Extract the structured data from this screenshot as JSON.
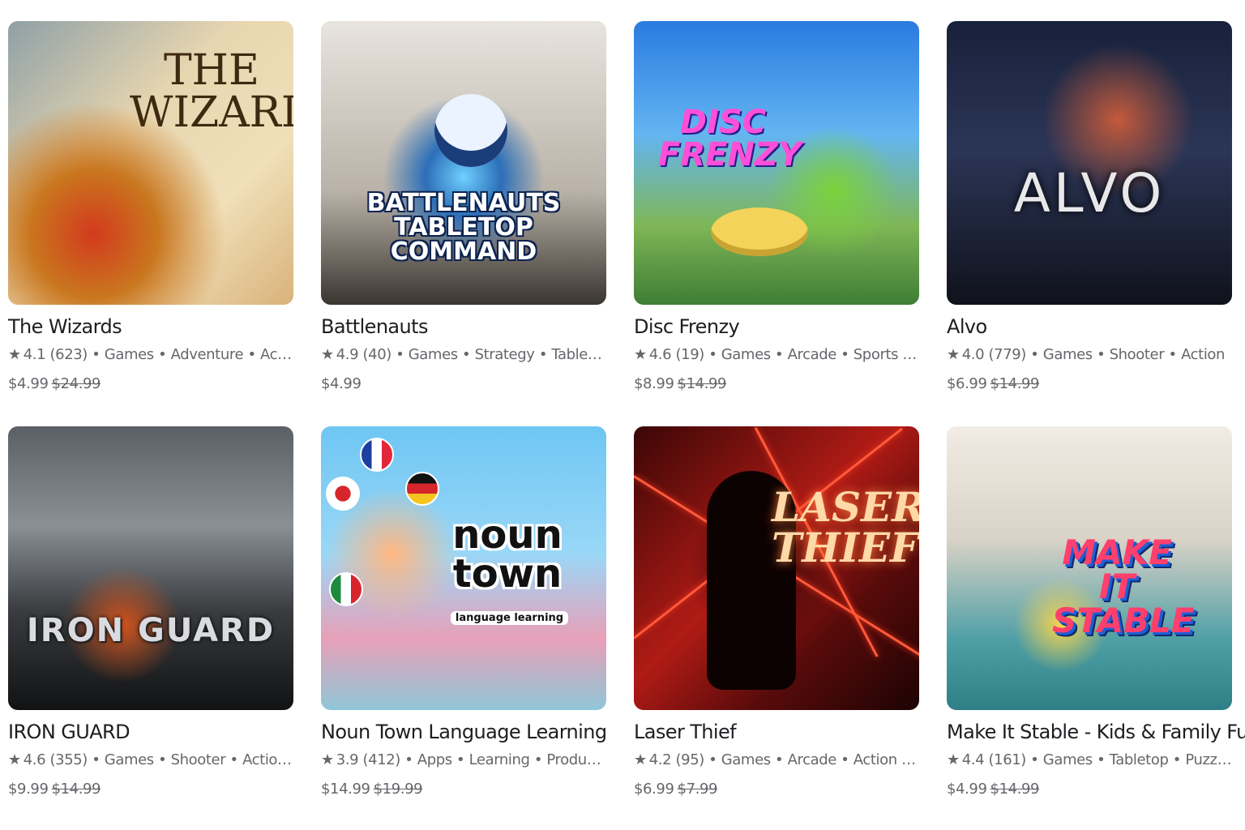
{
  "apps": [
    {
      "art_title": "THE\nWIZARDS",
      "name": "The Wizards",
      "rating": "4.1",
      "reviews": "(623)",
      "categories": "Games • Adventure • Action",
      "price": "$4.99",
      "original_price": "$24.99"
    },
    {
      "art_title": "BATTLENAUTS\nTABLETOP COMMAND",
      "name": "Battlenauts",
      "rating": "4.9",
      "reviews": "(40)",
      "categories": "Games • Strategy • Tabletop • Hangout",
      "price": "$4.99",
      "original_price": ""
    },
    {
      "art_title": "DISC\nFRENZY",
      "name": "Disc Frenzy",
      "rating": "4.6",
      "reviews": "(19)",
      "categories": "Games • Arcade • Sports • Action • Si...",
      "price": "$8.99",
      "original_price": "$14.99"
    },
    {
      "art_title": "ALVO",
      "name": "Alvo",
      "rating": "4.0",
      "reviews": "(779)",
      "categories": "Games • Shooter • Action",
      "price": "$6.99",
      "original_price": "$14.99"
    },
    {
      "art_title": "IRON GUARD",
      "name": "IRON GUARD",
      "rating": "4.6",
      "reviews": "(355)",
      "categories": "Games • Shooter • Action • Strategy",
      "price": "$9.99",
      "original_price": "$14.99"
    },
    {
      "art_title": "noun\ntown",
      "art_subtitle": "language learning",
      "name": "Noun Town Language Learning",
      "rating": "3.9",
      "reviews": "(412)",
      "categories": "Apps • Learning • Productivity • Tra...",
      "price": "$14.99",
      "original_price": "$19.99"
    },
    {
      "art_title": "LASER\nTHIEF",
      "name": "Laser Thief",
      "rating": "4.2",
      "reviews": "(95)",
      "categories": "Games • Arcade • Action • Simulation",
      "price": "$6.99",
      "original_price": "$7.99"
    },
    {
      "art_title": "MAKE IT\nSTABLE",
      "name": "Make It Stable - Kids & Family Fun!",
      "rating": "4.4",
      "reviews": "(161)",
      "categories": "Games • Tabletop • Puzzle • Simulati...",
      "price": "$4.99",
      "original_price": "$14.99"
    }
  ],
  "icons": {
    "star": "star-icon"
  },
  "colors": {
    "title_text": "#1c1e21",
    "secondary_text": "#65676b",
    "background": "#ffffff"
  }
}
